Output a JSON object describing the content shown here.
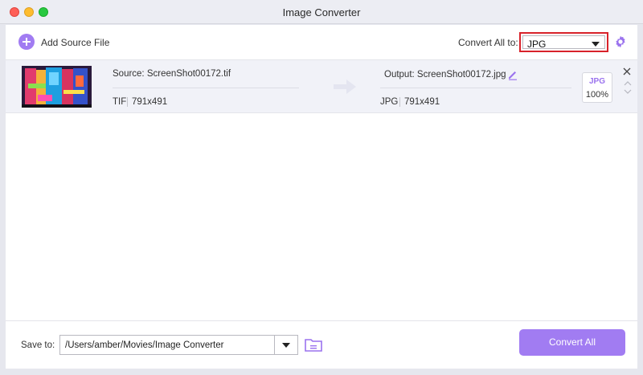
{
  "window": {
    "title": "Image Converter"
  },
  "toolbar": {
    "add_label": "Add Source File",
    "convert_all_label": "Convert All to:",
    "format_value": "JPG"
  },
  "file": {
    "source_name": "Source: ScreenShot00172.tif",
    "source_format": "TIF",
    "source_dimensions": "791x491",
    "output_name": "Output: ScreenShot00172.jpg",
    "output_format": "JPG",
    "output_dimensions": "791x491",
    "card_format": "JPG",
    "card_quality": "100%"
  },
  "footer": {
    "save_label": "Save to:",
    "save_path": "/Users/amber/Movies/Image Converter",
    "convert_button": "Convert All"
  },
  "colors": {
    "accent": "#a17cf2",
    "highlight_border": "#d8222a"
  }
}
